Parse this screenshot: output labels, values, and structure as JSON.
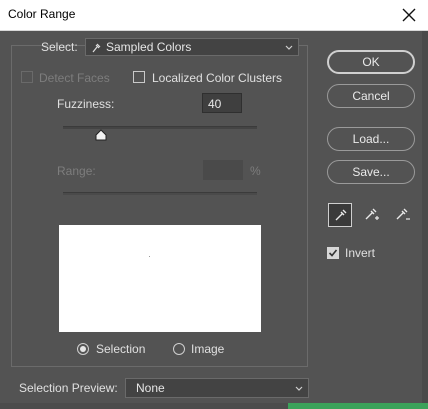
{
  "window": {
    "title": "Color Range"
  },
  "select": {
    "label": "Select:",
    "value": "Sampled Colors"
  },
  "detect_faces": {
    "label": "Detect Faces",
    "checked": false,
    "enabled": false
  },
  "localized": {
    "label": "Localized Color Clusters",
    "checked": false
  },
  "fuzziness": {
    "label": "Fuzziness:",
    "value": "40",
    "slider_fraction": 0.2
  },
  "range": {
    "label": "Range:",
    "value": "",
    "unit": "%",
    "enabled": false
  },
  "buttons": {
    "ok": "OK",
    "cancel": "Cancel",
    "load": "Load...",
    "save": "Save..."
  },
  "eyedroppers": [
    "eyedropper-icon",
    "eyedropper-plus-icon",
    "eyedropper-minus-icon"
  ],
  "invert": {
    "label": "Invert",
    "checked": true
  },
  "view": {
    "selection_label": "Selection",
    "image_label": "Image",
    "selected": "selection"
  },
  "selection_preview": {
    "label": "Selection Preview:",
    "value": "None"
  }
}
